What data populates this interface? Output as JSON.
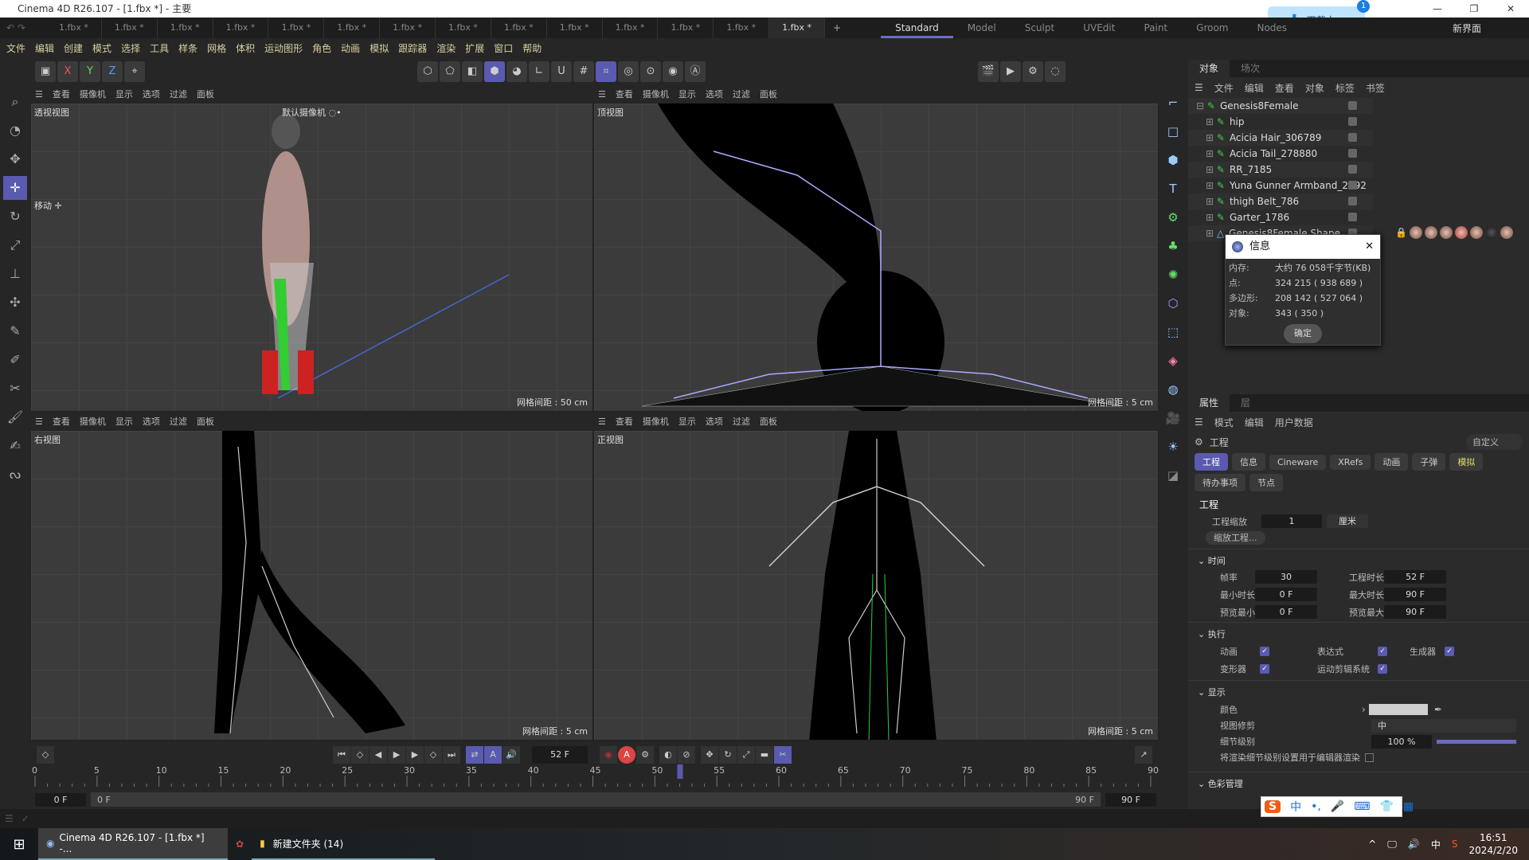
{
  "window": {
    "title": "Cinema 4D R26.107 - [1.fbx *] - 主要",
    "controls": [
      "—",
      "❐",
      "✕"
    ]
  },
  "file_tabs": [
    "1.fbx *",
    "1.fbx *",
    "1.fbx *",
    "1.fbx *",
    "1.fbx *",
    "1.fbx *",
    "1.fbx *",
    "1.fbx *",
    "1.fbx *",
    "1.fbx *",
    "1.fbx *",
    "1.fbx *",
    "1.fbx *",
    "1.fbx *"
  ],
  "active_tab_index": 13,
  "layouts": [
    "Standard",
    "Model",
    "Sculpt",
    "UVEdit",
    "Paint",
    "Groom",
    "Nodes"
  ],
  "active_layout": "Standard",
  "new_layout": "新界面",
  "download": {
    "label": "下载中...",
    "badge": "1"
  },
  "menu": [
    "文件",
    "编辑",
    "创建",
    "模式",
    "选择",
    "工具",
    "样条",
    "网格",
    "体积",
    "运动图形",
    "角色",
    "动画",
    "模拟",
    "跟踪器",
    "渲染",
    "扩展",
    "窗口",
    "帮助"
  ],
  "toolbar": {
    "axes": [
      "X",
      "Y",
      "Z"
    ]
  },
  "viewport_menu": [
    "查看",
    "摄像机",
    "显示",
    "选项",
    "过滤",
    "面板"
  ],
  "viewports": [
    {
      "name": "透视视图",
      "grid": "网格间距 : 50 cm",
      "camera": "默认摄像机 ◌•",
      "tool": "移动 ✛"
    },
    {
      "name": "顶视图",
      "grid": "网格间距 : 5 cm"
    },
    {
      "name": "右视图",
      "grid": "网格间距 : 5 cm"
    },
    {
      "name": "正视图",
      "grid": "网格间距 : 5 cm"
    }
  ],
  "object_manager": {
    "tabs": [
      "对象",
      "场次"
    ],
    "menu": [
      "文件",
      "编辑",
      "查看",
      "对象",
      "标签",
      "书签"
    ],
    "objects": [
      "Genesis8Female",
      "hip",
      "Acicia Hair_306789",
      "Acicia Tail_278880",
      "RR_7185",
      "Yuna Gunner Armband_2492",
      "thigh Belt_786",
      "Garter_1786",
      "Genesis8Female.Shape"
    ]
  },
  "info_dialog": {
    "title": "信息",
    "rows": [
      {
        "k": "内存:",
        "v": "大约 76 058千字节(KB)"
      },
      {
        "k": "点:",
        "v": "324 215 ( 938 689 )"
      },
      {
        "k": "多边形:",
        "v": "208 142 ( 527 064 )"
      },
      {
        "k": "对象:",
        "v": "343 ( 350 )"
      }
    ],
    "ok": "确定"
  },
  "attributes": {
    "tabs": [
      "属性",
      "层"
    ],
    "menu": [
      "模式",
      "编辑",
      "用户数据"
    ],
    "object": "工程",
    "preset": "自定义",
    "buttons": [
      "工程",
      "信息",
      "Cineware",
      "XRefs",
      "动画",
      "子弹",
      "模拟",
      "待办事项",
      "节点"
    ],
    "section_title": "工程",
    "scale_label": "工程缩放",
    "scale_value": "1",
    "scale_unit": "厘米",
    "scale_btn": "缩放工程...",
    "time": {
      "title": "时间",
      "fps_l": "帧率",
      "fps": "30",
      "dur_l": "工程时长",
      "dur": "52 F",
      "min_l": "最小时长",
      "min": "0 F",
      "max_l": "最大时长",
      "max": "90 F",
      "pmin_l": "预览最小",
      "pmin": "0 F",
      "pmax_l": "预览最大",
      "pmax": "90 F"
    },
    "exec": {
      "title": "执行",
      "items": [
        "动画",
        "表达式",
        "生成器",
        "变形器",
        "运动剪辑系统"
      ]
    },
    "display": {
      "title": "显示",
      "color_l": "颜色",
      "color": "#d0d0d0",
      "clip_l": "视图修剪",
      "clip": "中",
      "lod_l": "细节级别",
      "lod": "100 %",
      "lod_fraction": 1.0,
      "render_lod": "将渲染细节级别设置用于编辑器渲染"
    },
    "color_mgmt": "色彩管理"
  },
  "timeline": {
    "current": "52 F",
    "current_frame": 52,
    "ticks": [
      "0",
      "5",
      "10",
      "15",
      "20",
      "25",
      "30",
      "35",
      "40",
      "45",
      "50",
      "55",
      "60",
      "65",
      "70",
      "75",
      "80",
      "85",
      "90"
    ],
    "start": "0 F",
    "range_start": "0 F",
    "range_end": "90 F",
    "end": "90 F"
  },
  "taskbar": {
    "items": [
      "Cinema 4D R26.107 - [1.fbx *] -...",
      "新建文件夹 (14)"
    ],
    "time": "16:51",
    "date": "2024/2/20",
    "ime": "中"
  },
  "ime_bar": [
    "中",
    "•,",
    "🎤",
    "⌨",
    "👕",
    "▦"
  ]
}
